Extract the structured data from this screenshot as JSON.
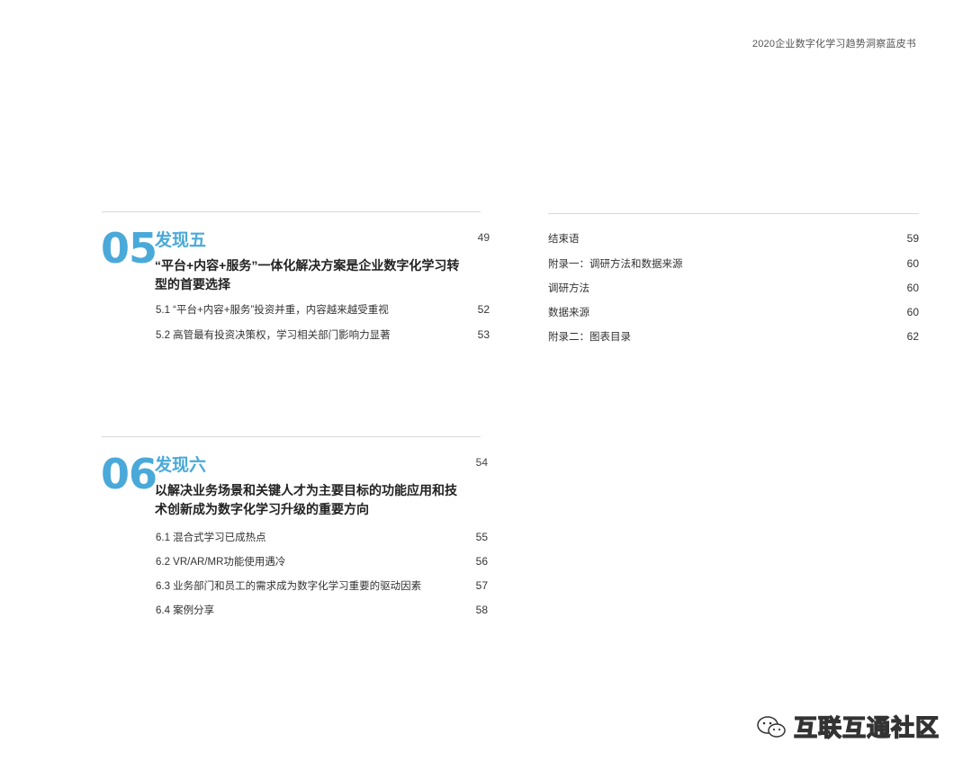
{
  "header": {
    "title": "2020企业数字化学习趋势洞察蓝皮书"
  },
  "sections": [
    {
      "number": "05",
      "title": "发现五",
      "page": "49",
      "heading_line1": "“平台+内容+服务”一体化解决方案是企业数字化学习转",
      "heading_line2": "型的首要选择",
      "items": [
        {
          "label": "5.1 “平台+内容+服务”投资并重，内容越来越受重视",
          "page": "52"
        },
        {
          "label": "5.2 高管最有投资决策权，学习相关部门影响力显著",
          "page": "53"
        }
      ]
    },
    {
      "number": "06",
      "title": "发现六",
      "page": "54",
      "heading_line1": "以解决业务场景和关键人才为主要目标的功能应用和技",
      "heading_line2": "术创新成为数字化学习升级的重要方向",
      "items": [
        {
          "label": "6.1 混合式学习已成热点",
          "page": "55"
        },
        {
          "label": "6.2 VR/AR/MR功能使用遇冷",
          "page": "56"
        },
        {
          "label": "6.3 业务部门和员工的需求成为数字化学习重要的驱动因素",
          "page": "57"
        },
        {
          "label": "6.4 案例分享",
          "page": "58"
        }
      ]
    }
  ],
  "right_toc": [
    {
      "label": "结束语",
      "page": "59"
    },
    {
      "label": "附录一：调研方法和数据来源",
      "page": "60"
    },
    {
      "label": "调研方法",
      "page": "60"
    },
    {
      "label": "数据来源",
      "page": "60"
    },
    {
      "label": "附录二：图表目录",
      "page": "62"
    }
  ],
  "watermark": {
    "text": "互联互通社区",
    "icon": "wechat-icon"
  }
}
